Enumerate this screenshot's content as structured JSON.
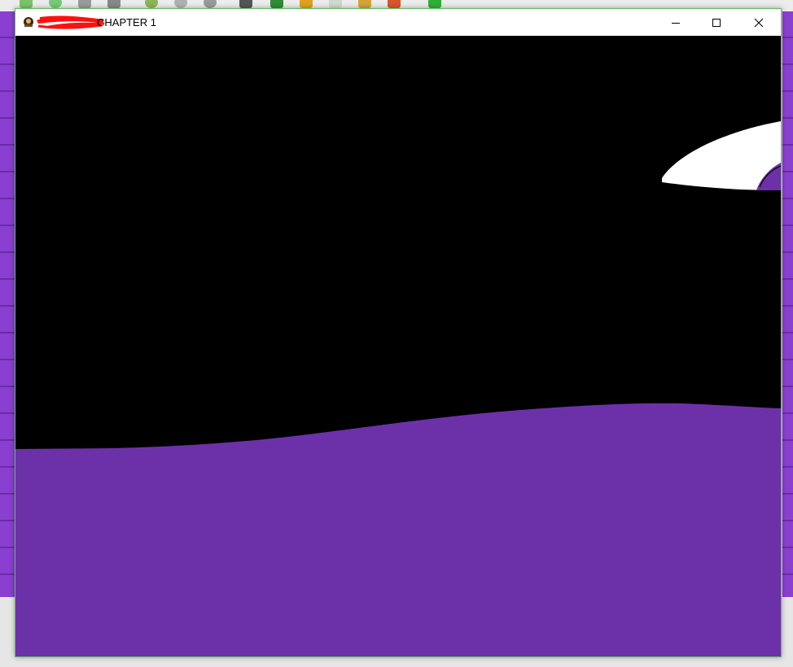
{
  "window": {
    "title": "CHAPTER 1"
  },
  "controls": {
    "minimize_icon": "minimize-icon",
    "maximize_icon": "maximize-icon",
    "close_icon": "close-icon"
  },
  "colors": {
    "ground": "#6c31a8",
    "sky": "#000000",
    "cloud": "#ffffff",
    "editor_purple": "#8a3fd1"
  }
}
